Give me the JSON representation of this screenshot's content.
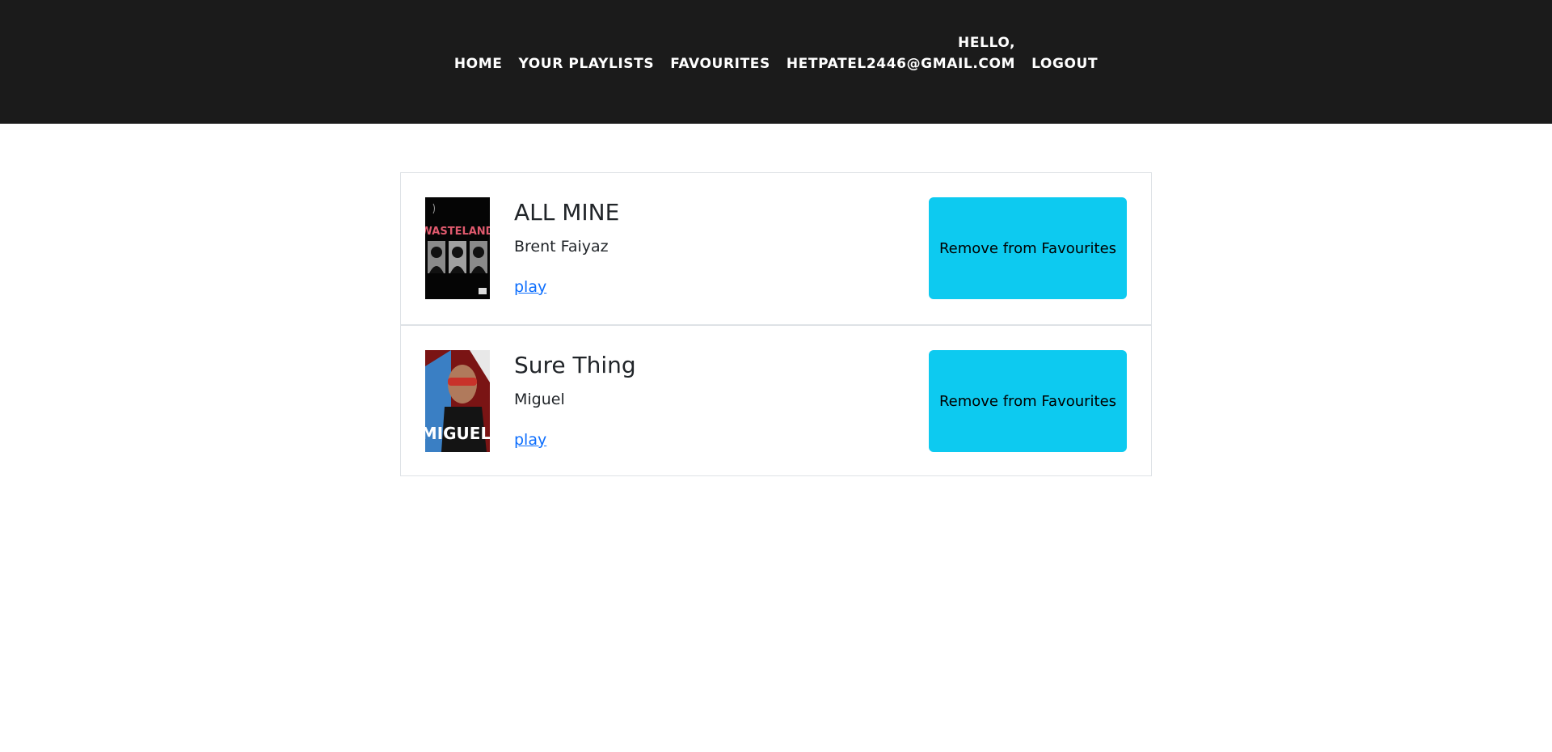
{
  "nav": {
    "home": "HOME",
    "playlists": "YOUR PLAYLISTS",
    "favourites": "FAVOURITES",
    "hello": "HELLO,",
    "email": "HETPATEL2446@GMAIL.COM",
    "logout": "LOGOUT"
  },
  "songs": [
    {
      "title": "ALL MINE",
      "artist": "Brent Faiyaz",
      "play_label": "play",
      "remove_label": "Remove from Favourites",
      "cover_text": "WASTELAND"
    },
    {
      "title": "Sure Thing",
      "artist": "Miguel",
      "play_label": "play",
      "remove_label": "Remove from Favourites",
      "cover_text": "MIGUEL"
    }
  ],
  "colors": {
    "navbar_bg": "#1b1b1b",
    "button_bg": "#0dcaf0",
    "link": "#0d6efd"
  }
}
